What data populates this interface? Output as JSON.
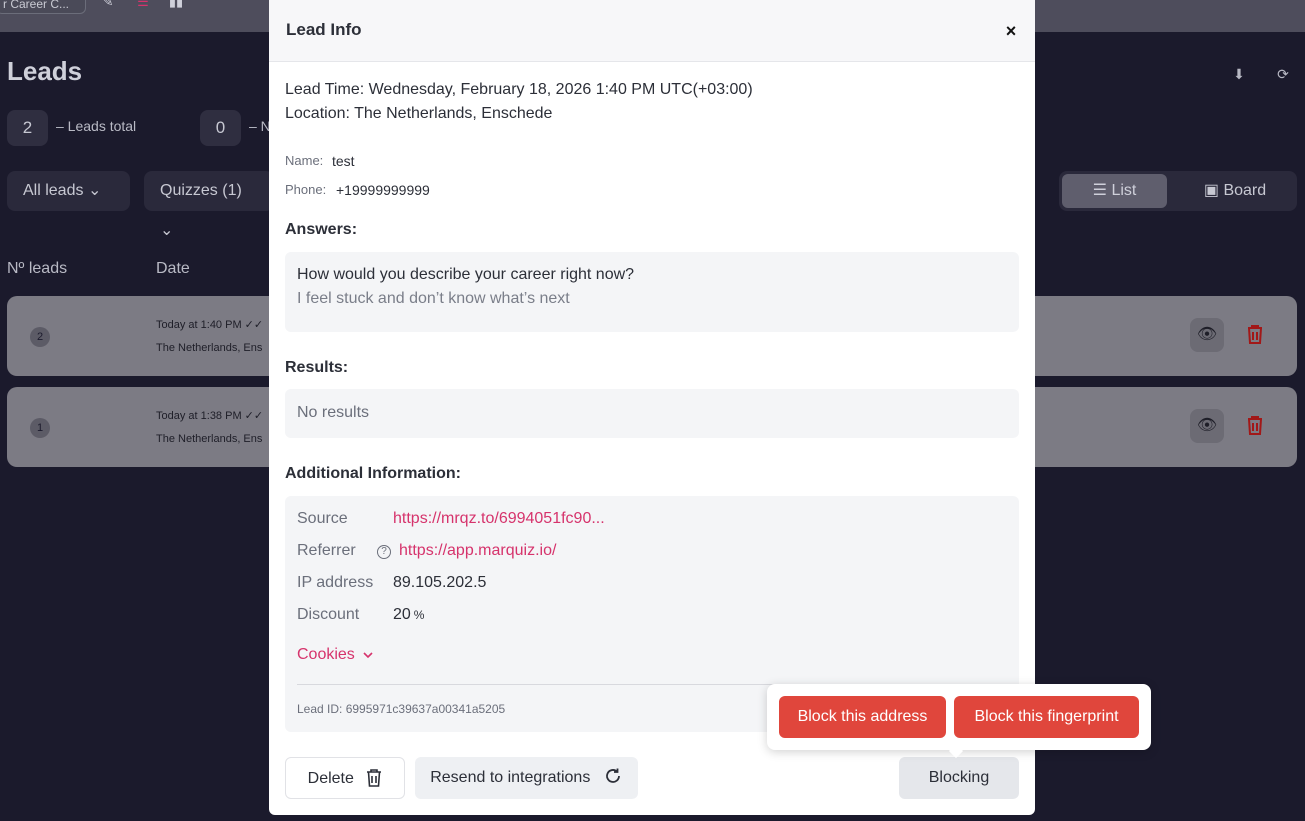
{
  "background": {
    "quiz_chip": "r Career C...",
    "page_title": "Leads",
    "stats": [
      {
        "value": "2",
        "label": "– Leads total"
      },
      {
        "value": "0",
        "label": "– N"
      }
    ],
    "filters": {
      "all_leads": "All leads",
      "quizzes": "Quizzes (1)"
    },
    "view_toggle": {
      "list": "List",
      "board": "Board"
    },
    "columns": {
      "num": "Nº leads",
      "date": "Date"
    },
    "rows": [
      {
        "num": "2",
        "date": "Today at 1:40 PM",
        "location": "The Netherlands, Ens"
      },
      {
        "num": "1",
        "date": "Today at 1:38 PM",
        "location": "The Netherlands, Ens"
      }
    ]
  },
  "modal": {
    "title": "Lead Info",
    "close": "×",
    "lead_time": "Lead Time: Wednesday, February 18, 2026 1:40 PM UTC(+03:00)",
    "location": "Location: The Netherlands, Enschede",
    "name_label": "Name:",
    "name_value": "test",
    "phone_label": "Phone:",
    "phone_value": "+19999999999",
    "answers_title": "Answers:",
    "question": "How would you describe your career right now?",
    "answer": "I feel stuck and don’t know what’s next",
    "results_title": "Results:",
    "no_results": "No results",
    "additional_title": "Additional Information:",
    "source_label": "Source",
    "source_value": "https://mrqz.to/6994051fc90...",
    "referrer_label": "Referrer",
    "referrer_help": "?",
    "referrer_value": "https://app.marquiz.io/",
    "ip_label": "IP address",
    "ip_value": "89.105.202.5",
    "discount_label": "Discount",
    "discount_value": "20",
    "discount_unit": "%",
    "cookies": "Cookies",
    "lead_id": "Lead ID: 6995971c39637a00341a5205",
    "delete_button": "Delete",
    "resend_button": "Resend to integrations",
    "blocking_button": "Blocking"
  },
  "popover": {
    "block_address": "Block this address",
    "block_fingerprint": "Block this fingerprint"
  },
  "colors": {
    "accent_link": "#d6336c",
    "danger": "#e0463c",
    "backdrop": "#1b1a2c"
  }
}
